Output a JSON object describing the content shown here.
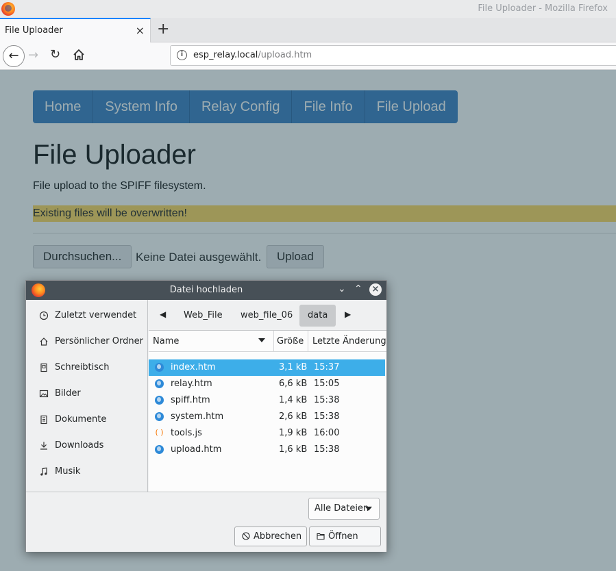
{
  "window": {
    "title": "File Uploader - Mozilla Firefox"
  },
  "tab": {
    "label": "File Uploader",
    "close": "×",
    "new_tab": "+"
  },
  "nav": {
    "back": "←",
    "forward": "→",
    "reload": "↻",
    "url_host": "esp_relay.local",
    "url_path": "/upload.htm"
  },
  "page": {
    "menu": [
      "Home",
      "System Info",
      "Relay Config",
      "File Info",
      "File Upload"
    ],
    "heading": "File Uploader",
    "subtitle": "File upload to the SPIFF filesystem.",
    "warning": "Existing files will be overwritten!",
    "browse_label": "Durchsuchen...",
    "no_file_text": "Keine Datei ausgewählt.",
    "upload_label": "Upload"
  },
  "dialog": {
    "title": "Datei hochladen",
    "places": [
      {
        "label": "Zuletzt verwendet",
        "icon": "clock-icon"
      },
      {
        "label": "Persönlicher Ordner",
        "icon": "home-icon"
      },
      {
        "label": "Schreibtisch",
        "icon": "desktop-icon"
      },
      {
        "label": "Bilder",
        "icon": "image-icon"
      },
      {
        "label": "Dokumente",
        "icon": "document-icon"
      },
      {
        "label": "Downloads",
        "icon": "download-icon"
      },
      {
        "label": "Musik",
        "icon": "music-icon"
      }
    ],
    "path": [
      "Web_File",
      "web_file_06",
      "data"
    ],
    "columns": {
      "name": "Name",
      "size": "Größe",
      "modified": "Letzte Änderung"
    },
    "files": [
      {
        "name": "index.htm",
        "size": "3,1 kB",
        "time": "15:37",
        "icon": "html-file-icon",
        "selected": true
      },
      {
        "name": "relay.htm",
        "size": "6,6 kB",
        "time": "15:05",
        "icon": "html-file-icon",
        "selected": false
      },
      {
        "name": "spiff.htm",
        "size": "1,4 kB",
        "time": "15:38",
        "icon": "html-file-icon",
        "selected": false
      },
      {
        "name": "system.htm",
        "size": "2,6 kB",
        "time": "15:38",
        "icon": "html-file-icon",
        "selected": false
      },
      {
        "name": "tools.js",
        "size": "1,9 kB",
        "time": "16:00",
        "icon": "js-file-icon",
        "selected": false
      },
      {
        "name": "upload.htm",
        "size": "1,6 kB",
        "time": "15:38",
        "icon": "html-file-icon",
        "selected": false
      }
    ],
    "filter_label": "Alle Dateien",
    "cancel_label": "Abbrechen",
    "open_label": "Öffnen"
  },
  "colors": {
    "menu_bg": "#3a7fc4",
    "warning_bg": "#ffd75e",
    "selection": "#3daee9",
    "dialog_titlebar": "#475057"
  }
}
